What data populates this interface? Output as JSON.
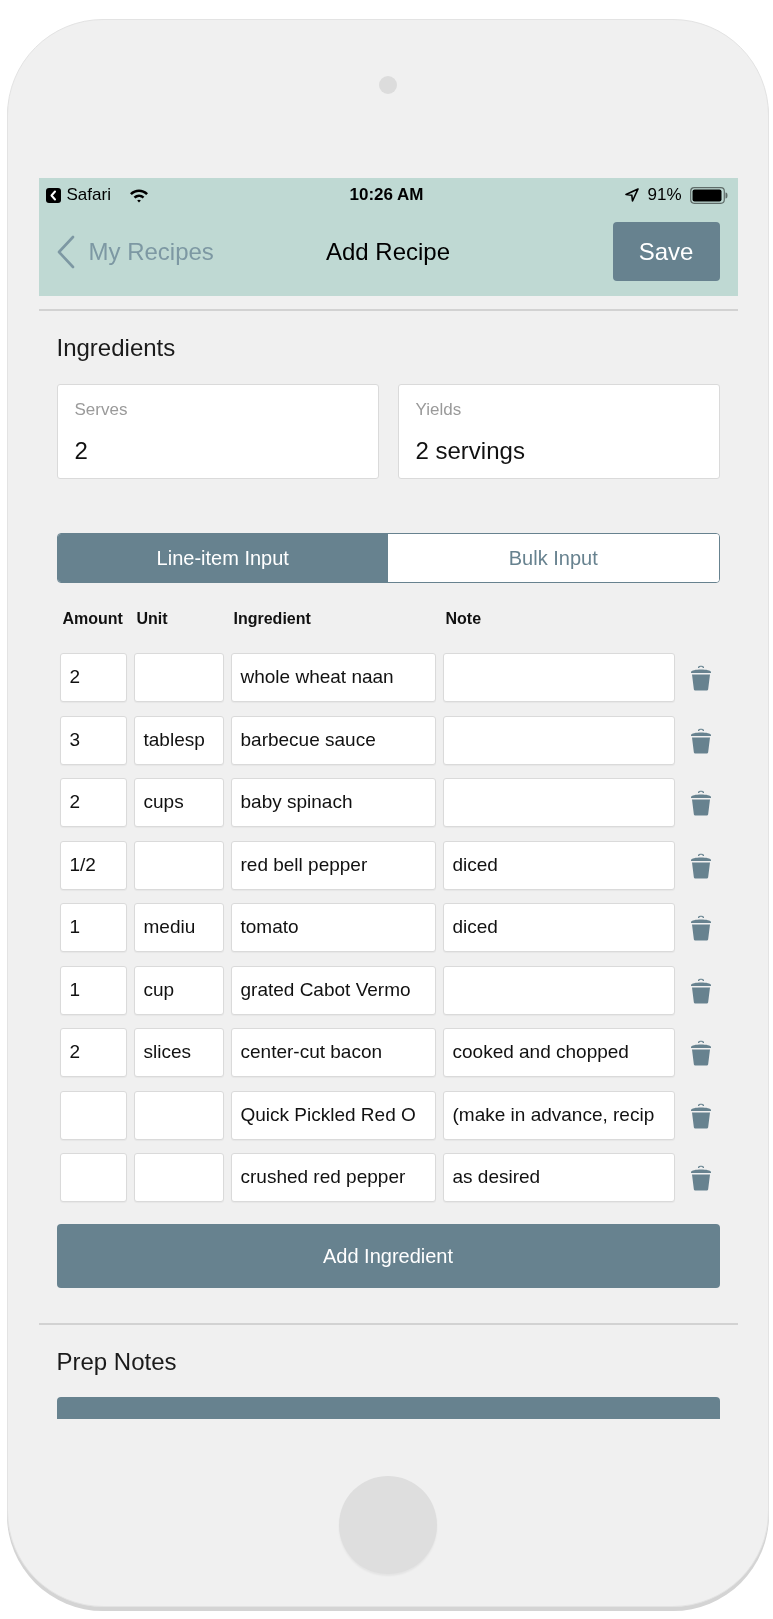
{
  "status_bar": {
    "back_app": "Safari",
    "time": "10:26 AM",
    "battery": "91%"
  },
  "nav_bar": {
    "back_label": "My Recipes",
    "title": "Add Recipe",
    "action": "Save"
  },
  "ingredients_section": {
    "title": "Ingredients",
    "fields": [
      {
        "label": "Serves",
        "value": "2"
      },
      {
        "label": "Yields",
        "value": "2 servings"
      }
    ],
    "tabs": [
      {
        "label": "Line-item Input",
        "selected": true
      },
      {
        "label": "Bulk Input",
        "selected": false
      }
    ],
    "table": {
      "columns": [
        "Amount",
        "Unit",
        "Ingredient",
        "Note"
      ],
      "rows": [
        {
          "amount": "2",
          "ingredient": "whole wheat naan"
        },
        {
          "amount": "3",
          "unit": "tablesp",
          "ingredient": "barbecue sauce"
        },
        {
          "amount": "2",
          "unit": "cups",
          "ingredient": "baby spinach"
        },
        {
          "amount": "1/2",
          "ingredient": "red bell pepper",
          "note": "diced"
        },
        {
          "amount": "1",
          "unit": "mediu",
          "ingredient": "tomato",
          "note": "diced"
        },
        {
          "amount": "1",
          "unit": "cup",
          "ingredient": "grated Cabot Vermo"
        },
        {
          "amount": "2",
          "unit": "slices",
          "ingredient": "center-cut bacon",
          "note": "cooked and chopped"
        },
        {
          "ingredient": "Quick Pickled Red O",
          "note": "(make in advance, recip"
        },
        {
          "ingredient": "crushed red pepper",
          "note": "as desired"
        }
      ]
    },
    "add_button": "Add Ingredient"
  },
  "prep_notes_section": {
    "title": "Prep Notes"
  }
}
